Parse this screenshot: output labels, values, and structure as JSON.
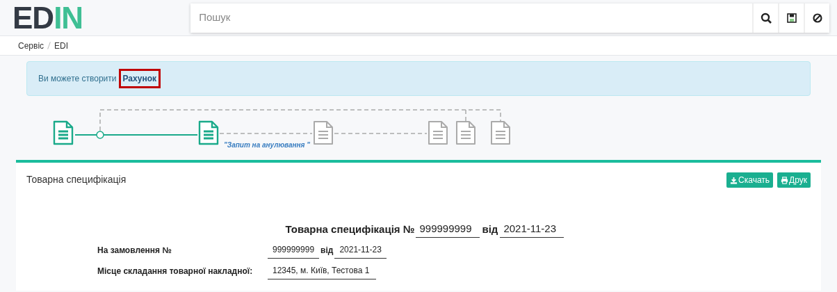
{
  "logo": {
    "dark": "ED",
    "accent": "IN"
  },
  "search": {
    "placeholder": "Пошук"
  },
  "toolbar_buttons": [
    {
      "kind": "search"
    },
    {
      "kind": "save"
    },
    {
      "kind": "cancel"
    }
  ],
  "breadcrumb": [
    "Сервіс",
    "EDI"
  ],
  "alert": {
    "text": "Ви можете створити",
    "link": "Рахунок",
    "highlighted": true
  },
  "flow": {
    "nodes": [
      {
        "active": true
      },
      {
        "active": true
      },
      {
        "active": false
      },
      {
        "active": false
      },
      {
        "active": false
      },
      {
        "active": false
      }
    ],
    "label": "\"Запит на анулювання \""
  },
  "card": {
    "title": "Товарна специфікація",
    "buttons": [
      {
        "kind": "download",
        "label": "Скачать"
      },
      {
        "kind": "print",
        "label": "Друк"
      }
    ]
  },
  "document": {
    "heading": "Товарна специфікація №",
    "number": "999999999",
    "from": "від",
    "date": "2021-11-23",
    "rows": [
      {
        "label": "На замовлення №",
        "values": [
          "999999999",
          "від",
          "2021-11-23"
        ]
      },
      {
        "label": "Місце складання товарної накладної:",
        "values": [
          "12345, м. Київ, Тестова 1"
        ]
      }
    ]
  }
}
